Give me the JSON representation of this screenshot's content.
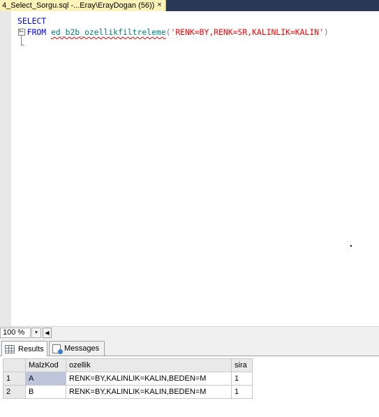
{
  "tab": {
    "title": "4_Select_Sorgu.sql -...Eray\\ErayDogan (56))",
    "close_glyph": "×"
  },
  "editor": {
    "line1": {
      "keyword": "SELECT"
    },
    "line2": {
      "star": "*",
      "from": "FROM",
      "function": "ed_b2b_ozellikfiltreleme",
      "open_paren": "(",
      "argument": "'RENK=BY,RENK=SR,KALINLIK=KALIN'",
      "close_paren": ")"
    },
    "collapse_glyph": "−"
  },
  "zoombar": {
    "zoom_value": "100 %",
    "dropdown_glyph": "▼",
    "scroll_left_glyph": "◀"
  },
  "results_tabs": [
    {
      "label": "Results",
      "icon": "grid-icon"
    },
    {
      "label": "Messages",
      "icon": "messages-icon"
    }
  ],
  "results": {
    "columns": [
      "MalzKod",
      "ozellik",
      "sira"
    ],
    "rows": [
      {
        "num": "1",
        "MalzKod": "A",
        "ozellik": "RENK=BY,KALINLIK=KALIN,BEDEN=M",
        "sira": "1"
      },
      {
        "num": "2",
        "MalzKod": "B",
        "ozellik": "RENK=BY,KALINLIK=KALIN,BEDEN=M",
        "sira": "1"
      }
    ]
  }
}
